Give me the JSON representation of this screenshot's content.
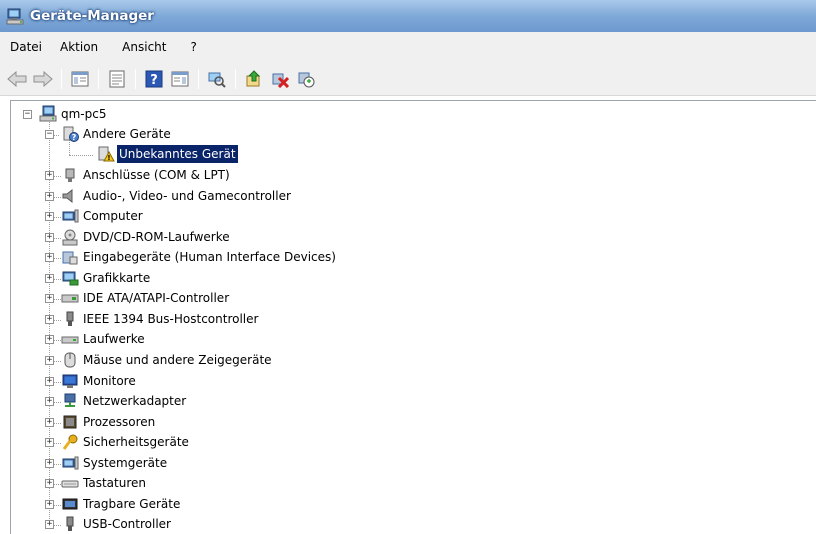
{
  "window": {
    "title": "Geräte-Manager"
  },
  "menu": [
    "Datei",
    "Aktion",
    "Ansicht",
    "?"
  ],
  "toolbar": {
    "buttons": [
      "back-icon",
      "forward-icon",
      "console-tree-icon",
      "properties-icon",
      "help-icon",
      "action-pane-icon",
      "scan-hardware-icon",
      "update-driver-icon",
      "uninstall-icon",
      "disable-icon"
    ]
  },
  "tree": {
    "root": "qm-pc5",
    "other_devices": "Andere Geräte",
    "unknown_device": "Unbekanntes Gerät",
    "categories": [
      "Anschlüsse (COM & LPT)",
      "Audio-, Video- und Gamecontroller",
      "Computer",
      "DVD/CD-ROM-Laufwerke",
      "Eingabegeräte (Human Interface Devices)",
      "Grafikkarte",
      "IDE ATA/ATAPI-Controller",
      "IEEE 1394 Bus-Hostcontroller",
      "Laufwerke",
      "Mäuse und andere Zeigegeräte",
      "Monitore",
      "Netzwerkadapter",
      "Prozessoren",
      "Sicherheitsgeräte",
      "Systemgeräte",
      "Tastaturen",
      "Tragbare Geräte",
      "USB-Controller"
    ]
  },
  "colors": {
    "selection": "#0a246a",
    "title_gradient_top": "#a9c9ea",
    "title_gradient_bottom": "#6d99cf"
  }
}
